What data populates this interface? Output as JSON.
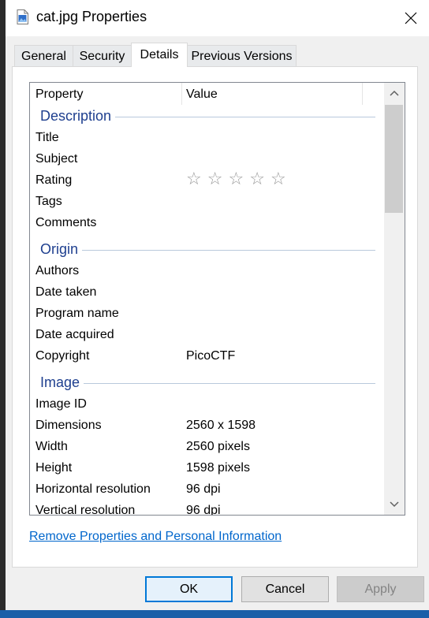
{
  "window": {
    "title": "cat.jpg Properties",
    "title_icon": "image-file-icon",
    "close_icon": "close-icon"
  },
  "tabs": [
    {
      "label": "General",
      "active": false
    },
    {
      "label": "Security",
      "active": false
    },
    {
      "label": "Details",
      "active": true
    },
    {
      "label": "Previous Versions",
      "active": false
    }
  ],
  "details": {
    "header": {
      "property": "Property",
      "value": "Value"
    },
    "groups": {
      "description": "Description",
      "origin": "Origin",
      "image": "Image"
    },
    "rows": {
      "title": {
        "property": "Title",
        "value": ""
      },
      "subject": {
        "property": "Subject",
        "value": ""
      },
      "rating": {
        "property": "Rating",
        "value": "",
        "stars": 0,
        "max_stars": 5
      },
      "tags": {
        "property": "Tags",
        "value": ""
      },
      "comments": {
        "property": "Comments",
        "value": ""
      },
      "authors": {
        "property": "Authors",
        "value": ""
      },
      "date_taken": {
        "property": "Date taken",
        "value": ""
      },
      "program_name": {
        "property": "Program name",
        "value": ""
      },
      "date_acquired": {
        "property": "Date acquired",
        "value": ""
      },
      "copyright": {
        "property": "Copyright",
        "value": "PicoCTF"
      },
      "image_id": {
        "property": "Image ID",
        "value": ""
      },
      "dimensions": {
        "property": "Dimensions",
        "value": "2560 x 1598"
      },
      "width": {
        "property": "Width",
        "value": "2560 pixels"
      },
      "height": {
        "property": "Height",
        "value": "1598 pixels"
      },
      "horizontal_resolution": {
        "property": "Horizontal resolution",
        "value": "96 dpi"
      },
      "vertical_resolution": {
        "property": "Vertical resolution",
        "value": "96 dpi"
      }
    },
    "scroll": {
      "position": 0.0,
      "visible_fraction": 0.25
    }
  },
  "remove_link": "Remove Properties and Personal Information",
  "buttons": {
    "ok": "OK",
    "cancel": "Cancel",
    "apply": "Apply",
    "apply_enabled": false
  },
  "colors": {
    "group_heading": "#1e3f8f",
    "link": "#0066cc",
    "default_button_border": "#0078d7"
  }
}
